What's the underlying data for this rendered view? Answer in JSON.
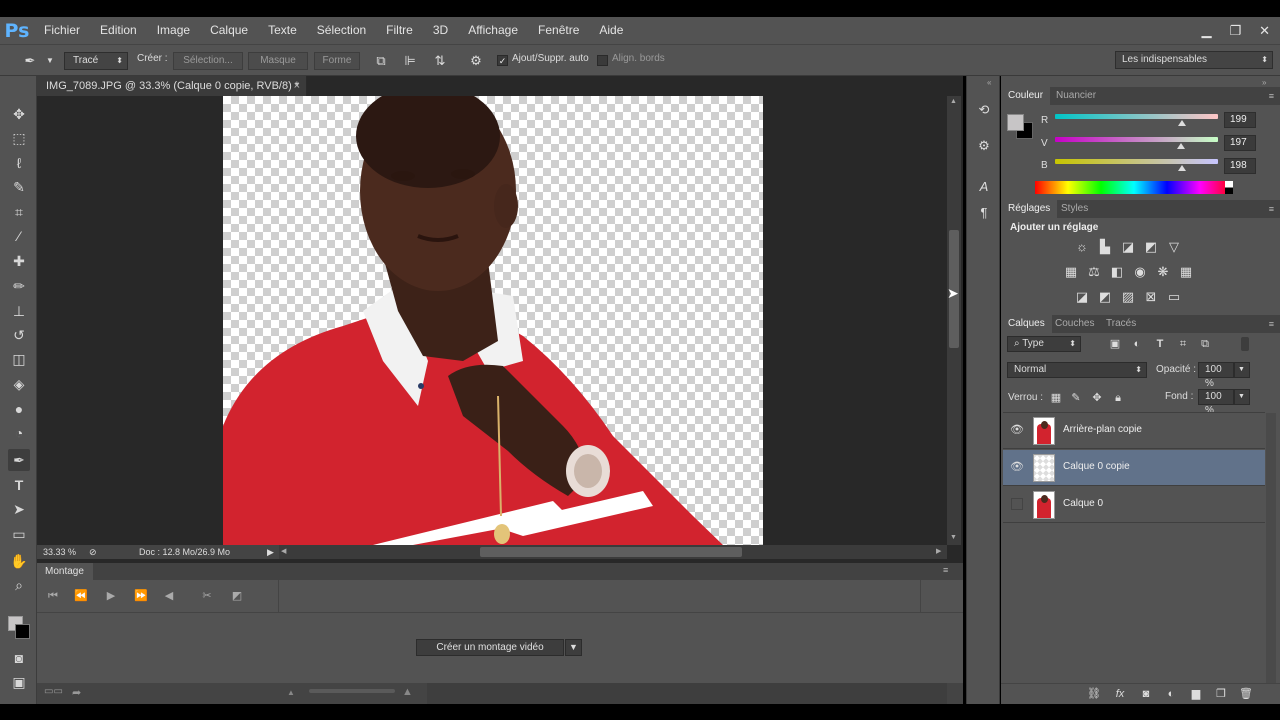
{
  "app": {
    "logo": "Ps"
  },
  "menu": [
    "Fichier",
    "Edition",
    "Image",
    "Calque",
    "Texte",
    "Sélection",
    "Filtre",
    "3D",
    "Affichage",
    "Fenêtre",
    "Aide"
  ],
  "options": {
    "tool_mode": "Tracé",
    "create_label": "Créer :",
    "selection_btn": "Sélection...",
    "mask_btn": "Masque",
    "shape_btn": "Forme",
    "auto_add_label": "Ajout/Suppr. auto",
    "align_edges_label": "Align. bords",
    "workspace": "Les indispensables"
  },
  "document": {
    "tab_title": "IMG_7089.JPG @ 33.3% (Calque 0 copie, RVB/8) *",
    "zoom": "33.33 %",
    "doc_info": "Doc : 12.8 Mo/26.9 Mo"
  },
  "timeline": {
    "tab": "Montage",
    "create_button": "Créer un montage vidéo"
  },
  "color_panel": {
    "tabs": [
      "Couleur",
      "Nuancier"
    ],
    "channels": [
      {
        "label": "R",
        "value": "199",
        "fraction": 0.78,
        "grad": "linear-gradient(90deg,#00c5c6,#ffc5c6)"
      },
      {
        "label": "V",
        "value": "197",
        "fraction": 0.77,
        "grad": "linear-gradient(90deg,#c700c6,#c7ffc6)"
      },
      {
        "label": "B",
        "value": "198",
        "fraction": 0.78,
        "grad": "linear-gradient(90deg,#c7c500,#c7c5ff)"
      }
    ],
    "foreground": "#c7c5c6",
    "background": "#000000"
  },
  "adjustments_panel": {
    "tabs": [
      "Réglages",
      "Styles"
    ],
    "title": "Ajouter un réglage"
  },
  "layers_panel": {
    "tabs": [
      "Calques",
      "Couches",
      "Tracés"
    ],
    "filter": "Type",
    "blend_mode": "Normal",
    "opacity_label": "Opacité :",
    "opacity": "100 %",
    "lock_label": "Verrou :",
    "fill_label": "Fond :",
    "fill": "100 %",
    "layers": [
      {
        "name": "Arrière-plan copie",
        "visible": true,
        "selected": false,
        "thumb": "person"
      },
      {
        "name": "Calque 0 copie",
        "visible": true,
        "selected": true,
        "thumb": "transparent"
      },
      {
        "name": "Calque 0",
        "visible": false,
        "selected": false,
        "thumb": "person"
      }
    ]
  },
  "colors": {
    "panel_bg": "#535353",
    "selected_layer": "#61728a",
    "shirt_red": "#d2232e",
    "skin": "#4b2a1e"
  }
}
